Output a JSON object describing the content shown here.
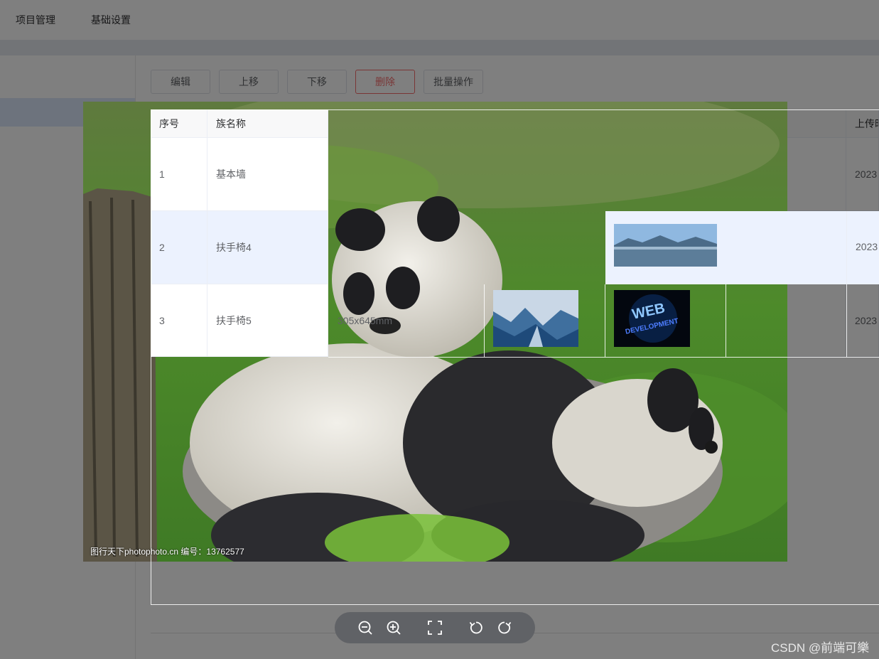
{
  "topnav": {
    "items": [
      {
        "label": "项目管理"
      },
      {
        "label": "基础设置"
      }
    ]
  },
  "toolbar_buttons": {
    "edit": "编辑",
    "move_up": "上移",
    "move_down": "下移",
    "delete": "删除",
    "batch": "批量操作"
  },
  "table": {
    "columns": [
      "序号",
      "族名称",
      "上传时"
    ],
    "rows": [
      {
        "index": "1",
        "name": "基本墙",
        "size": "",
        "upload_time": "2023"
      },
      {
        "index": "2",
        "name": "扶手椅4",
        "size": "",
        "upload_time": "2023"
      },
      {
        "index": "3",
        "name": "扶手椅5",
        "size": "305x645mm",
        "upload_time": "2023"
      }
    ]
  },
  "viewer": {
    "image_subject": "two giant pandas on grass beside a tree stump",
    "watermark": "图行天下photophoto.cn  编号：13762577",
    "tools": [
      "zoom-out-icon",
      "zoom-in-icon",
      "fullscreen-icon",
      "rotate-left-icon",
      "rotate-right-icon"
    ]
  },
  "csdn_watermark": "CSDN @前端可樂",
  "colors": {
    "accent": "#409eff",
    "danger": "#f56c6c",
    "highlight_row": "#ecf2fe",
    "mask": "rgba(0,0,0,0.5)"
  }
}
